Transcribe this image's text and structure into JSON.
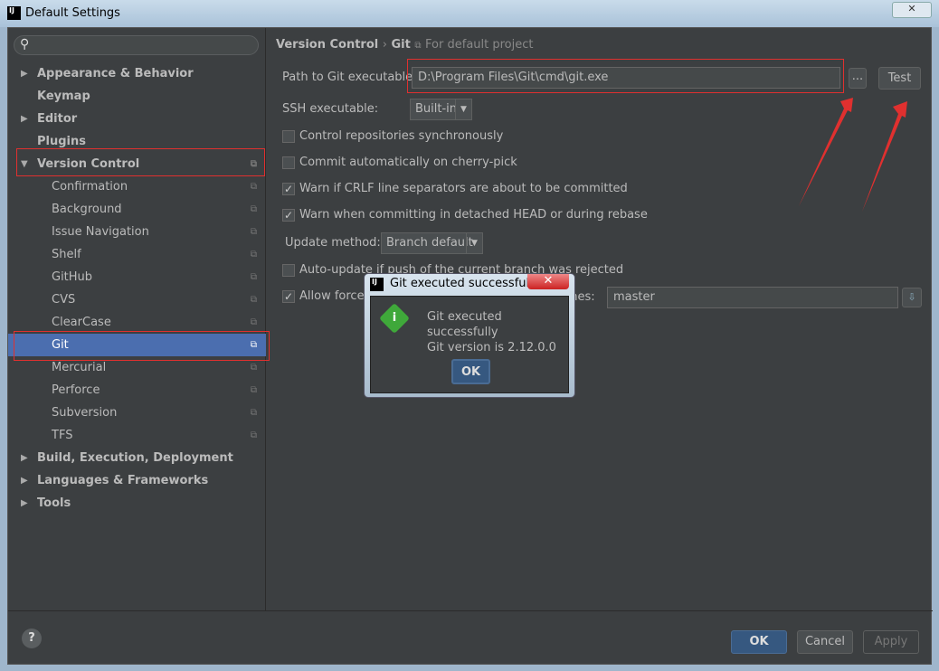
{
  "window": {
    "title": "Default Settings",
    "close": "✕"
  },
  "sidebar": {
    "search_placeholder": "",
    "items": [
      {
        "label": "Appearance & Behavior",
        "arrow": "▶",
        "bold": true
      },
      {
        "label": "Keymap",
        "bold": true
      },
      {
        "label": "Editor",
        "arrow": "▶",
        "bold": true
      },
      {
        "label": "Plugins",
        "bold": true
      },
      {
        "label": "Version Control",
        "arrow": "▼",
        "bold": true,
        "copy": true
      },
      {
        "label": "Confirmation",
        "child": true,
        "copy": true
      },
      {
        "label": "Background",
        "child": true,
        "copy": true
      },
      {
        "label": "Issue Navigation",
        "child": true,
        "copy": true
      },
      {
        "label": "Shelf",
        "child": true,
        "copy": true
      },
      {
        "label": "GitHub",
        "child": true,
        "copy": true
      },
      {
        "label": "CVS",
        "child": true,
        "copy": true
      },
      {
        "label": "ClearCase",
        "child": true,
        "copy": true
      },
      {
        "label": "Git",
        "child": true,
        "copy": true,
        "selected": true
      },
      {
        "label": "Mercurial",
        "child": true,
        "copy": true
      },
      {
        "label": "Perforce",
        "child": true,
        "copy": true
      },
      {
        "label": "Subversion",
        "child": true,
        "copy": true
      },
      {
        "label": "TFS",
        "child": true,
        "copy": true
      },
      {
        "label": "Build, Execution, Deployment",
        "arrow": "▶",
        "bold": true
      },
      {
        "label": "Languages & Frameworks",
        "arrow": "▶",
        "bold": true
      },
      {
        "label": "Tools",
        "arrow": "▶",
        "bold": true
      }
    ]
  },
  "breadcrumb": {
    "parent": "Version Control",
    "sep": "›",
    "current": "Git",
    "scope": "For default project"
  },
  "git": {
    "path_label": "Path to Git executable:",
    "path_value": "D:\\Program Files\\Git\\cmd\\git.exe",
    "browse": "...",
    "test": "Test",
    "ssh_label": "SSH executable:",
    "ssh_value": "Built-in",
    "checks": [
      {
        "label": "Control repositories synchronously",
        "checked": false
      },
      {
        "label": "Commit automatically on cherry-pick",
        "checked": false
      },
      {
        "label": "Warn if CRLF line separators are about to be committed",
        "checked": true
      },
      {
        "label": "Warn when committing in detached HEAD or during rebase",
        "checked": true
      }
    ],
    "update_label": "Update method:",
    "update_value": "Branch default",
    "autoupdate_label": "Auto-update if push of the current branch was rejected",
    "force_label": "Allow force push",
    "protected_label": "Protected branches:",
    "protected_value": "master"
  },
  "dialog": {
    "title": "Git executed successfully",
    "line1": "Git executed successfully",
    "line2": "Git version is 2.12.0.0",
    "ok": "OK",
    "close": "✕",
    "icon": "info-icon"
  },
  "footer": {
    "help": "?",
    "ok": "OK",
    "cancel": "Cancel",
    "apply": "Apply"
  },
  "colors": {
    "selection": "#4b6eaf",
    "annotation": "#e0302f",
    "success": "#3fa83a"
  }
}
